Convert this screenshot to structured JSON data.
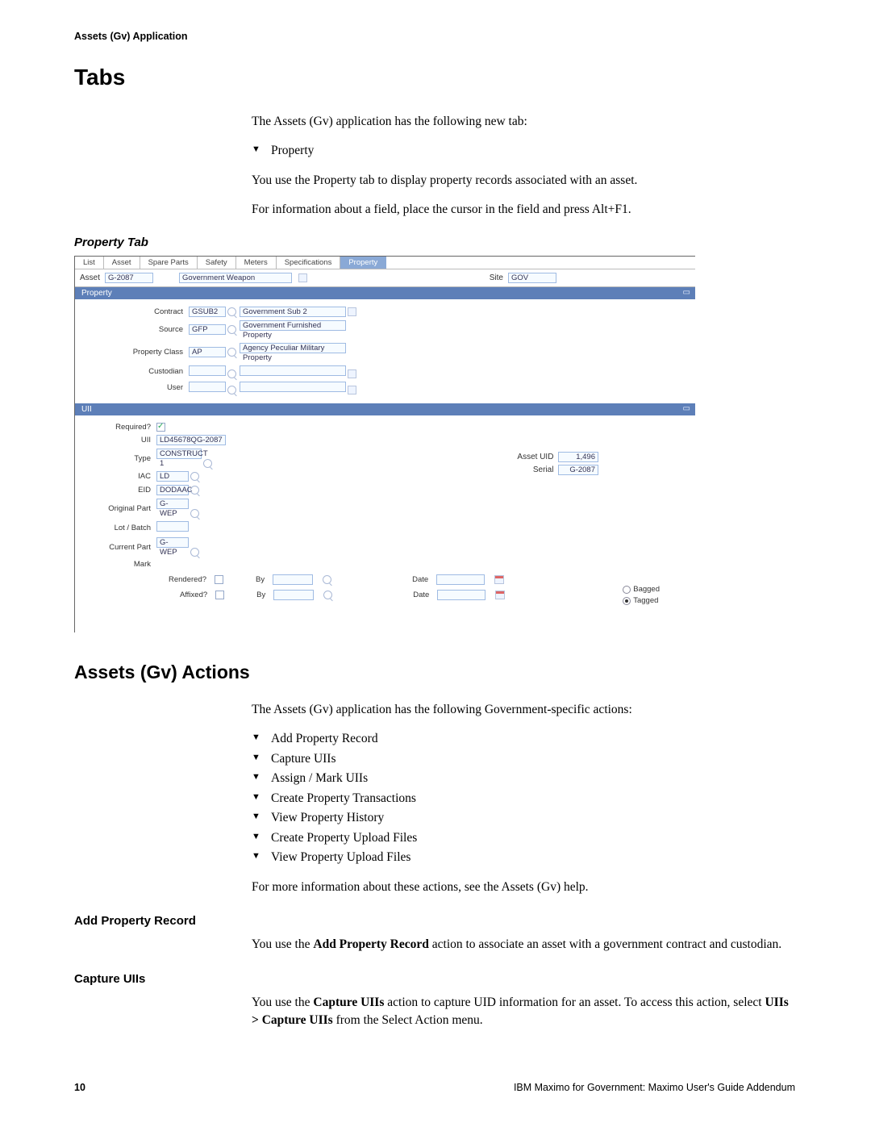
{
  "header": {
    "running": "Assets (Gv) Application"
  },
  "sec_tabs": {
    "title": "Tabs",
    "intro": "The Assets (Gv) application has the following new tab:",
    "items": [
      "Property"
    ],
    "p_use": "You use the Property tab to display property records associated with an asset.",
    "p_help": "For information about a field, place the cursor in the field and press Alt+F1.",
    "figcaption": "Property Tab"
  },
  "fig": {
    "tabs": [
      "List",
      "Asset",
      "Spare Parts",
      "Safety",
      "Meters",
      "Specifications",
      "Property"
    ],
    "active_tab_index": 6,
    "head": {
      "asset_label": "Asset",
      "asset_value": "G-2087",
      "asset_desc": "Government Weapon",
      "site_label": "Site",
      "site_value": "GOV"
    },
    "prop_section": {
      "title": "Property",
      "rows": {
        "contract_label": "Contract",
        "contract": "GSUB2",
        "contract_desc": "Government Sub 2",
        "source_label": "Source",
        "source": "GFP",
        "source_desc": "Government Furnished Property",
        "propclass_label": "Property Class",
        "propclass": "AP",
        "propclass_desc": "Agency Peculiar Military Property",
        "custodian_label": "Custodian",
        "custodian": "",
        "user_label": "User",
        "user": ""
      }
    },
    "uii_section": {
      "title": "UII",
      "left": {
        "required_label": "Required?",
        "required": true,
        "uii_label": "UII",
        "uii": "LD45678QG-2087",
        "type_label": "Type",
        "type": "CONSTRUCT 1",
        "iac_label": "IAC",
        "iac": "LD",
        "eid_label": "EID",
        "eid": "DODAAC",
        "origpart_label": "Original Part",
        "origpart": "G-WEP",
        "lot_label": "Lot / Batch",
        "lot": "",
        "curpart_label": "Current Part",
        "curpart": "G-WEP",
        "mark_label": "Mark"
      },
      "right": {
        "assetuid_label": "Asset UID",
        "assetuid": "1,496",
        "serial_label": "Serial",
        "serial": "G-2087"
      },
      "checks": {
        "rendered_label": "Rendered?",
        "by_label": "By",
        "date_label": "Date",
        "affixed_label": "Affixed?",
        "bagged_label": "Bagged",
        "tagged_label": "Tagged",
        "tagged_selected": true
      }
    }
  },
  "sec_actions": {
    "title": "Assets (Gv) Actions",
    "intro": "The Assets (Gv) application has the following Government-specific actions:",
    "items": [
      "Add Property Record",
      "Capture UIIs",
      "Assign / Mark UIIs",
      "Create Property Transactions",
      "View Property History",
      "Create Property Upload Files",
      "View Property Upload Files"
    ],
    "more": "For more information about these actions, see the Assets (Gv) help.",
    "sub_add": {
      "title": "Add Property Record",
      "p_before": "You use the ",
      "p_strong": "Add Property Record",
      "p_after": " action to associate an asset with a government contract and custodian."
    },
    "sub_capture": {
      "title": "Capture UIIs",
      "p_before": "You use the ",
      "p_strong": "Capture UIIs",
      "p_after1": " action to capture UID information for an asset. To access this action, select ",
      "p_path": "UIIs > Capture UIIs",
      "p_after2": " from the Select Action menu."
    }
  },
  "footer": {
    "page": "10",
    "booktitle": "IBM Maximo for Government: Maximo User's Guide Addendum"
  }
}
